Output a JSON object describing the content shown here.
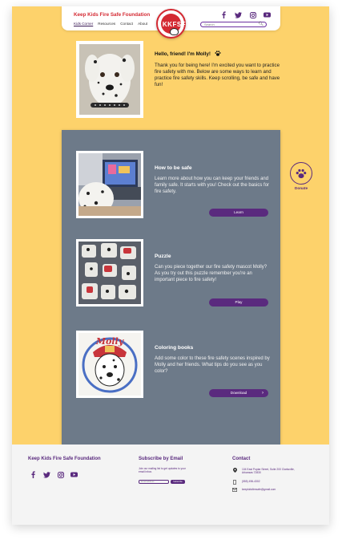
{
  "header": {
    "brand": "Keep Kids Fire Safe Foundation",
    "nav": [
      "Kids Corner",
      "Resources",
      "Contact",
      "About"
    ],
    "logo_text": "KKFSF",
    "search_placeholder": "Search",
    "socials": [
      "facebook-icon",
      "twitter-icon",
      "instagram-icon",
      "youtube-icon"
    ]
  },
  "intro": {
    "title": "Hello, friend! I'm Molly!",
    "text": "Thank you for being here! I'm excited you want to practice fire safety with me. Below are some ways to learn and practice fire safety skills. Keep scrolling, be safe and have fun!"
  },
  "cards": [
    {
      "title": "How to be safe",
      "text": "Learn more about how you can keep your friends and family safe. It starts with you! Check out the basics for fire safety.",
      "button": "Learn"
    },
    {
      "title": "Puzzle",
      "text": "Can you piece together our fire safety mascot Molly? As you try out this puzzle remember you're an important piece to fire safety!",
      "button": "Play"
    },
    {
      "title": "Coloring books",
      "text": "Add some color to these fire safety scenes inspired by Molly and her friends. What tips do you see as you color?",
      "button": "Download",
      "coloring_word": "Molly"
    }
  ],
  "donate": {
    "label": "Donate"
  },
  "footer": {
    "brand": "Keep Kids Fire Safe Foundation",
    "subscribe_title": "Subscribe by Email",
    "subscribe_text": "Join our mailing list to get updates to your email inbox.",
    "subscribe_placeholder": "Email address",
    "subscribe_button": "Subscribe",
    "contact_title": "Contact",
    "address": "104 East Poplar Street, Suite 200 Clarksville, Arkansas 72830",
    "phone": "(555) 496-4302",
    "email": "keepkidsfiresafe@gmail.com"
  },
  "colors": {
    "background": "#fdd26b",
    "panel": "#6d7a89",
    "accent": "#5a2a7e",
    "brand_red": "#d42a33"
  }
}
